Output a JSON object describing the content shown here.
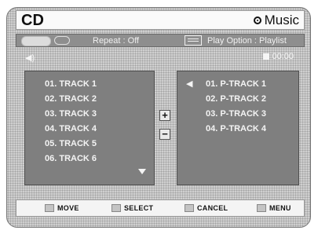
{
  "header": {
    "title": "CD",
    "mode_label": "Music",
    "mode_icon": "disc-icon"
  },
  "status": {
    "repeat_label": "Repeat : Off",
    "play_option_label": "Play Option : Playlist"
  },
  "info": {
    "time": "00:00"
  },
  "track_list": {
    "items": [
      "01. TRACK 1",
      "02. TRACK 2",
      "03. TRACK 3",
      "04. TRACK 4",
      "05. TRACK 5",
      "06. TRACK 6"
    ]
  },
  "controls": {
    "add": "+",
    "remove": "−"
  },
  "playlist": {
    "items": [
      "01. P-TRACK 1",
      "02. P-TRACK 2",
      "03. P-TRACK 3",
      "04. P-TRACK 4"
    ],
    "selected_index": 0
  },
  "footer": {
    "move": "MOVE",
    "select": "SELECT",
    "cancel": "CANCEL",
    "menu": "MENU"
  },
  "colors": {
    "panel": "#7f7f7f",
    "statusbar": "#8e8e8e",
    "frame": "#cfcfcf",
    "text_light": "#f4f4f4"
  }
}
